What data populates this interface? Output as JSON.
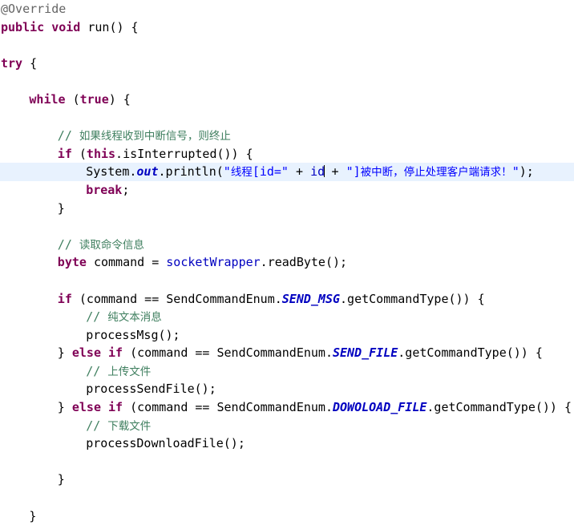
{
  "editor": {
    "language": "Java",
    "background_color": "#FFFFFF",
    "current_line_highlight_color": "#E8F2FE",
    "caret_color": "#000000",
    "theme_colors": {
      "annotation": "#646464",
      "keyword": "#7F0055",
      "comment": "#3F7F5F",
      "string": "#0000FF",
      "field": "#0000C0",
      "static_field": "#0000C0",
      "enum_constant": "#0000C0",
      "plain": "#000000"
    },
    "current_line_number": 6,
    "caret_after_text": "id"
  },
  "code": {
    "lines": [
      {
        "id": 1,
        "indent": 0,
        "kind": "annotation",
        "segments": [
          {
            "t": "annotation",
            "v": "@Override"
          }
        ]
      },
      {
        "id": 2,
        "indent": 0,
        "kind": "code",
        "segments": [
          {
            "t": "keyword",
            "v": "public"
          },
          {
            "t": "plain",
            "v": " "
          },
          {
            "t": "keyword",
            "v": "void"
          },
          {
            "t": "plain",
            "v": " run() {"
          }
        ]
      },
      {
        "id": 3,
        "indent": 0,
        "kind": "blank",
        "segments": []
      },
      {
        "id": 4,
        "indent": 0,
        "kind": "code",
        "segments": [
          {
            "t": "keyword",
            "v": "try"
          },
          {
            "t": "plain",
            "v": " {"
          }
        ]
      },
      {
        "id": 5,
        "indent": 0,
        "kind": "blank",
        "segments": []
      },
      {
        "id": 6,
        "indent": 1,
        "kind": "code",
        "segments": [
          {
            "t": "keyword",
            "v": "while"
          },
          {
            "t": "plain",
            "v": " ("
          },
          {
            "t": "keyword",
            "v": "true"
          },
          {
            "t": "plain",
            "v": ") {"
          }
        ]
      },
      {
        "id": 7,
        "indent": 0,
        "kind": "blank",
        "segments": []
      },
      {
        "id": 8,
        "indent": 2,
        "kind": "comment",
        "segments": [
          {
            "t": "comment",
            "v": "// "
          },
          {
            "t": "comment-cjk",
            "v": "如果线程收到中断信号，则终止"
          }
        ]
      },
      {
        "id": 9,
        "indent": 2,
        "kind": "code",
        "segments": [
          {
            "t": "keyword",
            "v": "if"
          },
          {
            "t": "plain",
            "v": " ("
          },
          {
            "t": "keyword",
            "v": "this"
          },
          {
            "t": "plain",
            "v": ".isInterrupted()) {"
          }
        ]
      },
      {
        "id": 10,
        "indent": 3,
        "kind": "code",
        "current": true,
        "segments": [
          {
            "t": "plain",
            "v": "System."
          },
          {
            "t": "static",
            "v": "out"
          },
          {
            "t": "plain",
            "v": ".println("
          },
          {
            "t": "string",
            "v": "\""
          },
          {
            "t": "string-cjk",
            "v": "线程"
          },
          {
            "t": "string",
            "v": "[id=\""
          },
          {
            "t": "plain",
            "v": " + "
          },
          {
            "t": "field",
            "v": "id"
          },
          {
            "t": "caret",
            "v": ""
          },
          {
            "t": "plain",
            "v": " + "
          },
          {
            "t": "string",
            "v": "\"]"
          },
          {
            "t": "string-cjk",
            "v": "被中断，停止处理客户端请求！"
          },
          {
            "t": "string",
            "v": "\""
          },
          {
            "t": "plain",
            "v": ");"
          }
        ]
      },
      {
        "id": 11,
        "indent": 3,
        "kind": "code",
        "segments": [
          {
            "t": "keyword",
            "v": "break"
          },
          {
            "t": "plain",
            "v": ";"
          }
        ]
      },
      {
        "id": 12,
        "indent": 2,
        "kind": "code",
        "segments": [
          {
            "t": "plain",
            "v": "}"
          }
        ]
      },
      {
        "id": 13,
        "indent": 0,
        "kind": "blank",
        "segments": []
      },
      {
        "id": 14,
        "indent": 2,
        "kind": "comment",
        "segments": [
          {
            "t": "comment",
            "v": "// "
          },
          {
            "t": "comment-cjk",
            "v": "读取命令信息"
          }
        ]
      },
      {
        "id": 15,
        "indent": 2,
        "kind": "code",
        "segments": [
          {
            "t": "keyword",
            "v": "byte"
          },
          {
            "t": "plain",
            "v": " command = "
          },
          {
            "t": "field",
            "v": "socketWrapper"
          },
          {
            "t": "plain",
            "v": ".readByte();"
          }
        ]
      },
      {
        "id": 16,
        "indent": 0,
        "kind": "blank",
        "segments": []
      },
      {
        "id": 17,
        "indent": 2,
        "kind": "code",
        "segments": [
          {
            "t": "keyword",
            "v": "if"
          },
          {
            "t": "plain",
            "v": " (command == SendCommandEnum."
          },
          {
            "t": "enum",
            "v": "SEND_MSG"
          },
          {
            "t": "plain",
            "v": ".getCommandType()) {"
          }
        ]
      },
      {
        "id": 18,
        "indent": 3,
        "kind": "comment",
        "segments": [
          {
            "t": "comment",
            "v": "// "
          },
          {
            "t": "comment-cjk",
            "v": "纯文本消息"
          }
        ]
      },
      {
        "id": 19,
        "indent": 3,
        "kind": "code",
        "segments": [
          {
            "t": "plain",
            "v": "processMsg();"
          }
        ]
      },
      {
        "id": 20,
        "indent": 2,
        "kind": "code",
        "segments": [
          {
            "t": "plain",
            "v": "} "
          },
          {
            "t": "keyword",
            "v": "else"
          },
          {
            "t": "plain",
            "v": " "
          },
          {
            "t": "keyword",
            "v": "if"
          },
          {
            "t": "plain",
            "v": " (command == SendCommandEnum."
          },
          {
            "t": "enum",
            "v": "SEND_FILE"
          },
          {
            "t": "plain",
            "v": ".getCommandType()) {"
          }
        ]
      },
      {
        "id": 21,
        "indent": 3,
        "kind": "comment",
        "segments": [
          {
            "t": "comment",
            "v": "// "
          },
          {
            "t": "comment-cjk",
            "v": "上传文件"
          }
        ]
      },
      {
        "id": 22,
        "indent": 3,
        "kind": "code",
        "segments": [
          {
            "t": "plain",
            "v": "processSendFile();"
          }
        ]
      },
      {
        "id": 23,
        "indent": 2,
        "kind": "code",
        "segments": [
          {
            "t": "plain",
            "v": "} "
          },
          {
            "t": "keyword",
            "v": "else"
          },
          {
            "t": "plain",
            "v": " "
          },
          {
            "t": "keyword",
            "v": "if"
          },
          {
            "t": "plain",
            "v": " (command == SendCommandEnum."
          },
          {
            "t": "enum",
            "v": "DOWOLOAD_FILE"
          },
          {
            "t": "plain",
            "v": ".getCommandType()) {"
          }
        ]
      },
      {
        "id": 24,
        "indent": 3,
        "kind": "comment",
        "segments": [
          {
            "t": "comment",
            "v": "// "
          },
          {
            "t": "comment-cjk",
            "v": "下载文件"
          }
        ]
      },
      {
        "id": 25,
        "indent": 3,
        "kind": "code",
        "segments": [
          {
            "t": "plain",
            "v": "processDownloadFile();"
          }
        ]
      },
      {
        "id": 26,
        "indent": 0,
        "kind": "blank",
        "segments": []
      },
      {
        "id": 27,
        "indent": 2,
        "kind": "code",
        "segments": [
          {
            "t": "plain",
            "v": "}"
          }
        ]
      },
      {
        "id": 28,
        "indent": 0,
        "kind": "blank",
        "segments": []
      },
      {
        "id": 29,
        "indent": 1,
        "kind": "code",
        "segments": [
          {
            "t": "plain",
            "v": "}"
          }
        ]
      }
    ]
  }
}
